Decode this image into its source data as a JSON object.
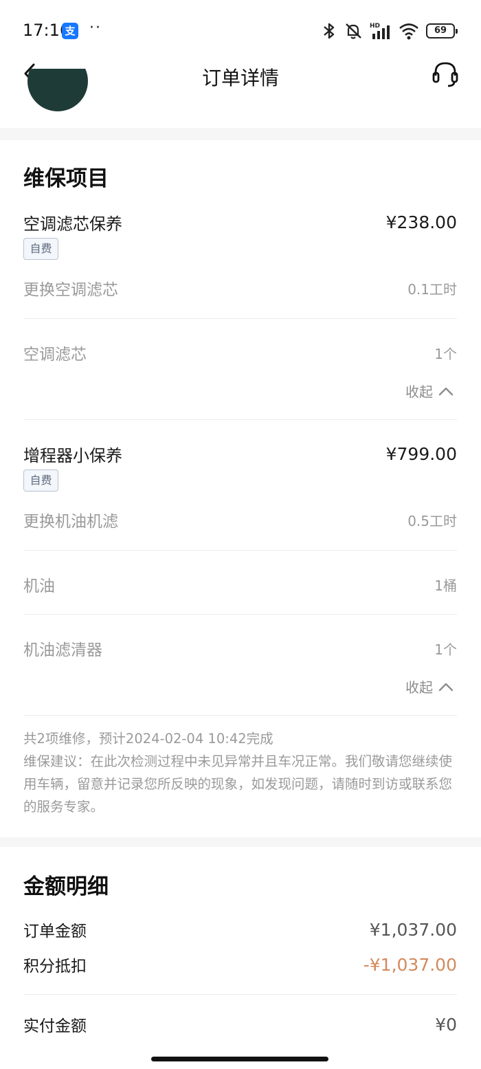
{
  "status_bar": {
    "time": "17:16",
    "alipay_badge": "支",
    "dots": "··",
    "battery": "69",
    "hd_label": "HD"
  },
  "nav": {
    "title": "订单详情"
  },
  "maintenance": {
    "title": "维保项目",
    "items": [
      {
        "name": "空调滤芯保养",
        "price": "¥238.00",
        "tag": "自费",
        "labor_name": "更换空调滤芯",
        "labor_hours": "0.1工时",
        "parts": [
          {
            "name": "空调滤芯",
            "qty": "1个"
          }
        ],
        "collapse_label": "收起"
      },
      {
        "name": "增程器小保养",
        "price": "¥799.00",
        "tag": "自费",
        "labor_name": "更换机油机滤",
        "labor_hours": "0.5工时",
        "parts": [
          {
            "name": "机油",
            "qty": "1桶"
          },
          {
            "name": "机油滤清器",
            "qty": "1个"
          }
        ],
        "collapse_label": "收起"
      }
    ],
    "summary_line": "共2项维修，预计2024-02-04 10:42完成",
    "advice": "维保建议：在此次检测过程中未见异常并且车况正常。我们敬请您继续使用车辆，留意并记录您所反映的现象，如发现问题，请随时到访或联系您的服务专家。"
  },
  "amount": {
    "title": "金额明细",
    "order_label": "订单金额",
    "order_value": "¥1,037.00",
    "points_label": "积分抵扣",
    "points_value": "-¥1,037.00",
    "paid_label": "实付金额",
    "paid_value": "¥0"
  },
  "colors": {
    "discount": "#d4895a",
    "tag_border": "#b9c3d3",
    "muted_text": "#9a9a9a"
  }
}
